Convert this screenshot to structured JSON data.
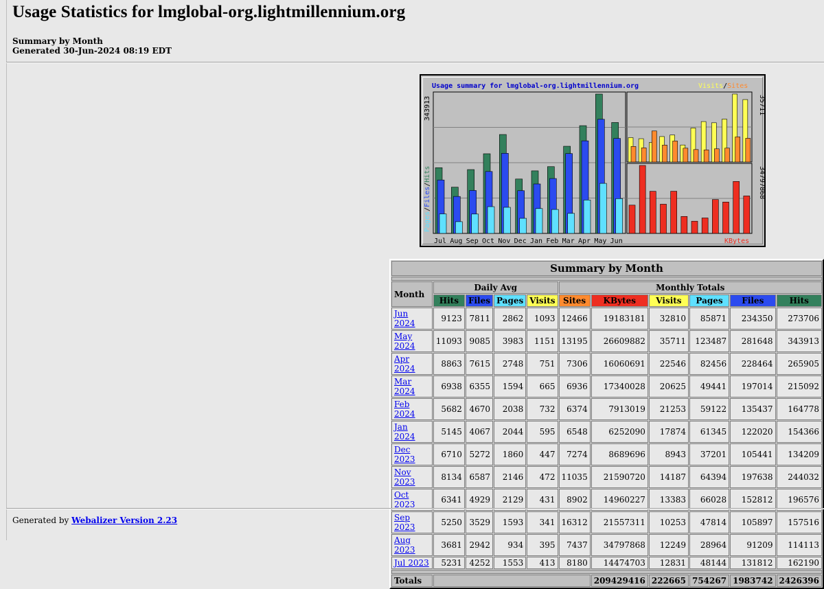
{
  "page": {
    "title": "Usage Statistics for lmglobal-org.lightmillennium.org",
    "subtitle": "Summary by Month",
    "generated": "Generated 30-Jun-2024 08:19 EDT",
    "footer_prefix": "Generated by",
    "footer_link": "Webalizer Version 2.23"
  },
  "graph": {
    "title": "Usage summary for lmglobal-org.lightmillennium.org",
    "left_axis_max": "343913",
    "left_legend": [
      "Pages",
      "Files",
      "Hits"
    ],
    "right_top_max": "35711",
    "right_top_legend": [
      "Visits",
      "Sites"
    ],
    "right_bottom_max": "34797868",
    "right_bottom_label": "KBytes",
    "months": [
      "Jul",
      "Aug",
      "Sep",
      "Oct",
      "Nov",
      "Dec",
      "Jan",
      "Feb",
      "Mar",
      "Apr",
      "May",
      "Jun"
    ],
    "colors": {
      "hits": "#33805c",
      "files": "#2b4bef",
      "pages": "#5fe0ff",
      "visits": "#ffff55",
      "sites": "#ff8a2e",
      "kbytes": "#ee2e21"
    }
  },
  "table": {
    "title": "Summary by Month",
    "month_header": "Month",
    "daily_avg": "Daily Avg",
    "monthly_totals": "Monthly Totals",
    "daily_cols": [
      "Hits",
      "Files",
      "Pages",
      "Visits"
    ],
    "monthly_cols": [
      "Sites",
      "KBytes",
      "Visits",
      "Pages",
      "Files",
      "Hits"
    ],
    "rows": [
      {
        "month": "Jun 2024",
        "d": [
          "9123",
          "7811",
          "2862",
          "1093"
        ],
        "m": [
          "12466",
          "19183181",
          "32810",
          "85871",
          "234350",
          "273706"
        ]
      },
      {
        "month": "May 2024",
        "d": [
          "11093",
          "9085",
          "3983",
          "1151"
        ],
        "m": [
          "13195",
          "26609882",
          "35711",
          "123487",
          "281648",
          "343913"
        ]
      },
      {
        "month": "Apr 2024",
        "d": [
          "8863",
          "7615",
          "2748",
          "751"
        ],
        "m": [
          "7306",
          "16060691",
          "22546",
          "82456",
          "228464",
          "265905"
        ]
      },
      {
        "month": "Mar 2024",
        "d": [
          "6938",
          "6355",
          "1594",
          "665"
        ],
        "m": [
          "6936",
          "17340028",
          "20625",
          "49441",
          "197014",
          "215092"
        ]
      },
      {
        "month": "Feb 2024",
        "d": [
          "5682",
          "4670",
          "2038",
          "732"
        ],
        "m": [
          "6374",
          "7913019",
          "21253",
          "59122",
          "135437",
          "164778"
        ]
      },
      {
        "month": "Jan 2024",
        "d": [
          "5145",
          "4067",
          "2044",
          "595"
        ],
        "m": [
          "6548",
          "6252090",
          "17874",
          "61345",
          "122020",
          "154366"
        ]
      },
      {
        "month": "Dec 2023",
        "d": [
          "6710",
          "5272",
          "1860",
          "447"
        ],
        "m": [
          "7274",
          "8689696",
          "8943",
          "37201",
          "105441",
          "134209"
        ]
      },
      {
        "month": "Nov 2023",
        "d": [
          "8134",
          "6587",
          "2146",
          "472"
        ],
        "m": [
          "11035",
          "21590720",
          "14187",
          "64394",
          "197638",
          "244032"
        ]
      },
      {
        "month": "Oct 2023",
        "d": [
          "6341",
          "4929",
          "2129",
          "431"
        ],
        "m": [
          "8902",
          "14960227",
          "13383",
          "66028",
          "152812",
          "196576"
        ]
      },
      {
        "month": "Sep 2023",
        "d": [
          "5250",
          "3529",
          "1593",
          "341"
        ],
        "m": [
          "16312",
          "21557311",
          "10253",
          "47814",
          "105897",
          "157516"
        ]
      },
      {
        "month": "Aug 2023",
        "d": [
          "3681",
          "2942",
          "934",
          "395"
        ],
        "m": [
          "7437",
          "34797868",
          "12249",
          "28964",
          "91209",
          "114113"
        ]
      },
      {
        "month": "Jul 2023",
        "d": [
          "5231",
          "4252",
          "1553",
          "413"
        ],
        "m": [
          "8180",
          "14474703",
          "12831",
          "48144",
          "131812",
          "162190"
        ]
      }
    ],
    "totals_label": "Totals",
    "totals": [
      "209429416",
      "222665",
      "754267",
      "1983742",
      "2426396"
    ]
  }
}
